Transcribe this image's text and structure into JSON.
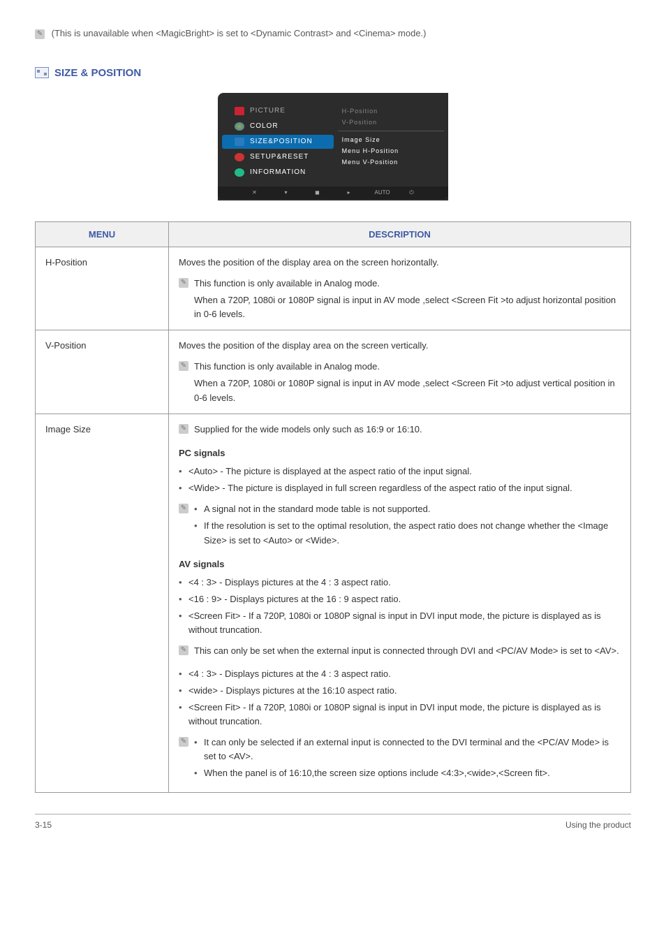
{
  "top_note": "(This is unavailable when <MagicBright> is set to <Dynamic Contrast> and <Cinema> mode.)",
  "section_title": "SIZE & POSITION",
  "osd": {
    "menu": [
      "PICTURE",
      "COLOR",
      "SIZE&POSITION",
      "SETUP&RESET",
      "INFORMATION"
    ],
    "sub": [
      "H-Position",
      "V-Position",
      "Image Size",
      "Menu H-Position",
      "Menu V-Position"
    ],
    "bottom": [
      "✕",
      "▾",
      "◼",
      "▸",
      "AUTO",
      "⏻"
    ]
  },
  "table": {
    "head_menu": "MENU",
    "head_desc": "DESCRIPTION",
    "rows": {
      "hpos": {
        "menu": "H-Position",
        "intro": "Moves the position of the display area on the screen horizontally.",
        "note1": "This function is only available in Analog mode.",
        "note2": "When a 720P, 1080i or 1080P signal is input in AV mode ,select <Screen Fit >to adjust horizontal position in 0-6 levels."
      },
      "vpos": {
        "menu": "V-Position",
        "intro": "Moves the position of the display area on the screen vertically.",
        "note1": "This function is only available in Analog mode.",
        "note2": "When a 720P, 1080i or 1080P signal is input in AV mode ,select <Screen Fit >to adjust vertical position in 0-6 levels."
      },
      "imgsize": {
        "menu": "Image Size",
        "topnote": "Supplied for the wide models only such as 16:9 or 16:10.",
        "pchead": "PC signals",
        "pc_auto": "<Auto> - The picture is displayed at the aspect ratio of the input signal.",
        "pc_wide": "<Wide> - The picture is displayed in full screen regardless of the aspect ratio of the input signal.",
        "pc_note_a": "A signal not in the standard mode table is not supported.",
        "pc_note_b": "If the resolution is set to the optimal resolution, the aspect ratio does not change whether the <Image Size> is set to <Auto> or <Wide>.",
        "avhead": "AV signals",
        "av_43": "<4 : 3> - Displays pictures at the 4 : 3 aspect ratio.",
        "av_169": "<16 : 9> - Displays pictures at the 16 : 9 aspect ratio.",
        "av_fit": "<Screen Fit> - If a 720P, 1080i or 1080P signal is input in DVI input mode, the picture is displayed as is without truncation.",
        "av_note": "This can only be set when the external input is connected through DVI and <PC/AV Mode> is set to <AV>.",
        "b_43": "<4 : 3> - Displays pictures at the 4 : 3 aspect ratio.",
        "b_wide": "<wide> - Displays pictures at the 16:10 aspect ratio.",
        "b_fit": "<Screen Fit> - If a 720P, 1080i or 1080P signal is input in DVI input mode, the picture is displayed as is without truncation.",
        "b_note_a": "It can only be selected if an external input is connected to the DVI terminal and the <PC/AV Mode> is set to <AV>.",
        "b_note_b": "When the panel is of 16:10,the screen size options include <4:3>,<wide>,<Screen fit>."
      }
    }
  },
  "footer_left": "3-15",
  "footer_right": "Using the product"
}
